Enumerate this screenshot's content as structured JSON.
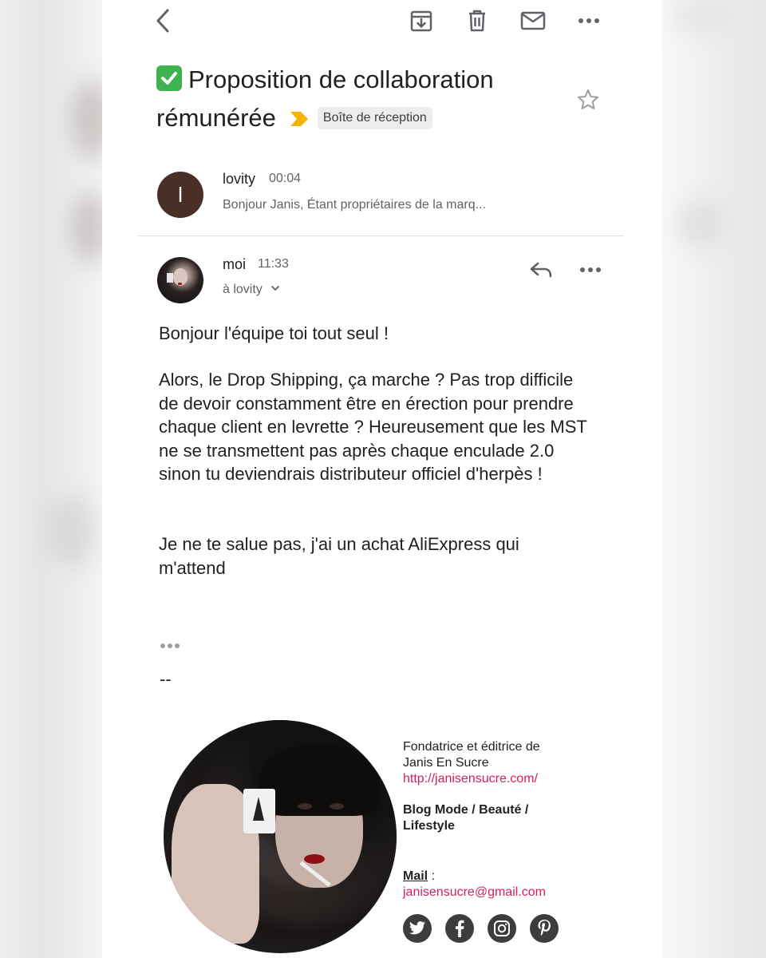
{
  "toolbar": {
    "back_icon": "chevron-left-icon",
    "archive_icon": "archive-icon",
    "delete_icon": "trash-icon",
    "unread_icon": "mail-icon",
    "more_icon": "more-horizontal-icon"
  },
  "subject": {
    "emoji": "✅",
    "line1": "Proposition de collaboration",
    "line2": "rémunérée",
    "label": "Boîte de réception"
  },
  "messages": [
    {
      "avatar_letter": "l",
      "sender": "lovity",
      "time": "00:04",
      "snippet": "Bonjour Janis, Étant propriétaires de la marq..."
    },
    {
      "sender": "moi",
      "time": "11:33",
      "recipient": "à lovity",
      "body": {
        "p1": "Bonjour l'équipe toi tout seul !",
        "p2": "Alors, le Drop Shipping, ça marche ? Pas trop difficile de devoir constamment être en érection pour prendre chaque client en levrette ? Heureusement que les MST ne se transmettent pas après chaque enculade 2.0 sinon tu deviendrais distributeur officiel d'herpès !",
        "p3": "Je ne te salue pas, j'ai un achat AliExpress qui m'attend"
      },
      "signature_separator": "--"
    }
  ],
  "signature": {
    "line1": "Fondatrice et éditrice de",
    "line2": "Janis En Sucre",
    "url": "http://janisensucre.com/",
    "tagline": "Blog Mode / Beauté / Lifestyle",
    "mail_label": "Mail",
    "mail_sep": " :",
    "email": "janisensucre@gmail.com",
    "socials": [
      "twitter-icon",
      "facebook-icon",
      "instagram-icon",
      "pinterest-icon"
    ]
  },
  "colors": {
    "check": "#3fb34f",
    "importance": "#f4b400",
    "link": "#d41f5a",
    "avatar_lovity": "#4a2f27"
  }
}
